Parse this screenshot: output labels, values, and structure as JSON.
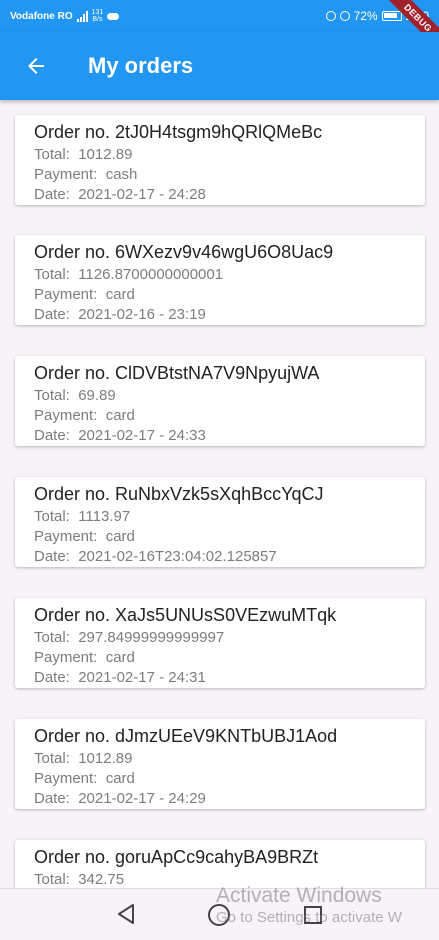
{
  "status_bar": {
    "carrier": "Vodafone RO",
    "network_type": "4G",
    "speed": "131",
    "speed_unit": "B/s",
    "battery": "72%",
    "time": "22:0"
  },
  "debug_banner": "DEBUG",
  "appbar": {
    "title": "My orders"
  },
  "labels": {
    "total": "Total:",
    "payment": "Payment:",
    "date": "Date:"
  },
  "orders": [
    {
      "title": "Order no. 2tJ0H4tsgm9hQRlQMeBc",
      "total": "1012.89",
      "payment": "cash",
      "date": "2021-02-17 - 24:28"
    },
    {
      "title": "Order no. 6WXezv9v46wgU6O8Uac9",
      "total": "1126.8700000000001",
      "payment": "card",
      "date": "2021-02-16 - 23:19"
    },
    {
      "title": "Order no. ClDVBtstNA7V9NpyujWA",
      "total": "69.89",
      "payment": "card",
      "date": "2021-02-17 - 24:33"
    },
    {
      "title": "Order no. RuNbxVzk5sXqhBccYqCJ",
      "total": "1113.97",
      "payment": "card",
      "date": "2021-02-16T23:04:02.125857"
    },
    {
      "title": "Order no. XaJs5UNUsS0VEzwuMTqk",
      "total": "297.84999999999997",
      "payment": "card",
      "date": "2021-02-17 - 24:31"
    },
    {
      "title": "Order no. dJmzUEeV9KNTbUBJ1Aod",
      "total": "1012.89",
      "payment": "card",
      "date": "2021-02-17 - 24:29"
    },
    {
      "title": "Order no. goruApCc9cahyBA9BRZt",
      "total": "342.75",
      "payment": "",
      "date": ""
    }
  ],
  "watermark": {
    "line1": "Activate Windows",
    "line2": "Go to Settings to activate W"
  }
}
